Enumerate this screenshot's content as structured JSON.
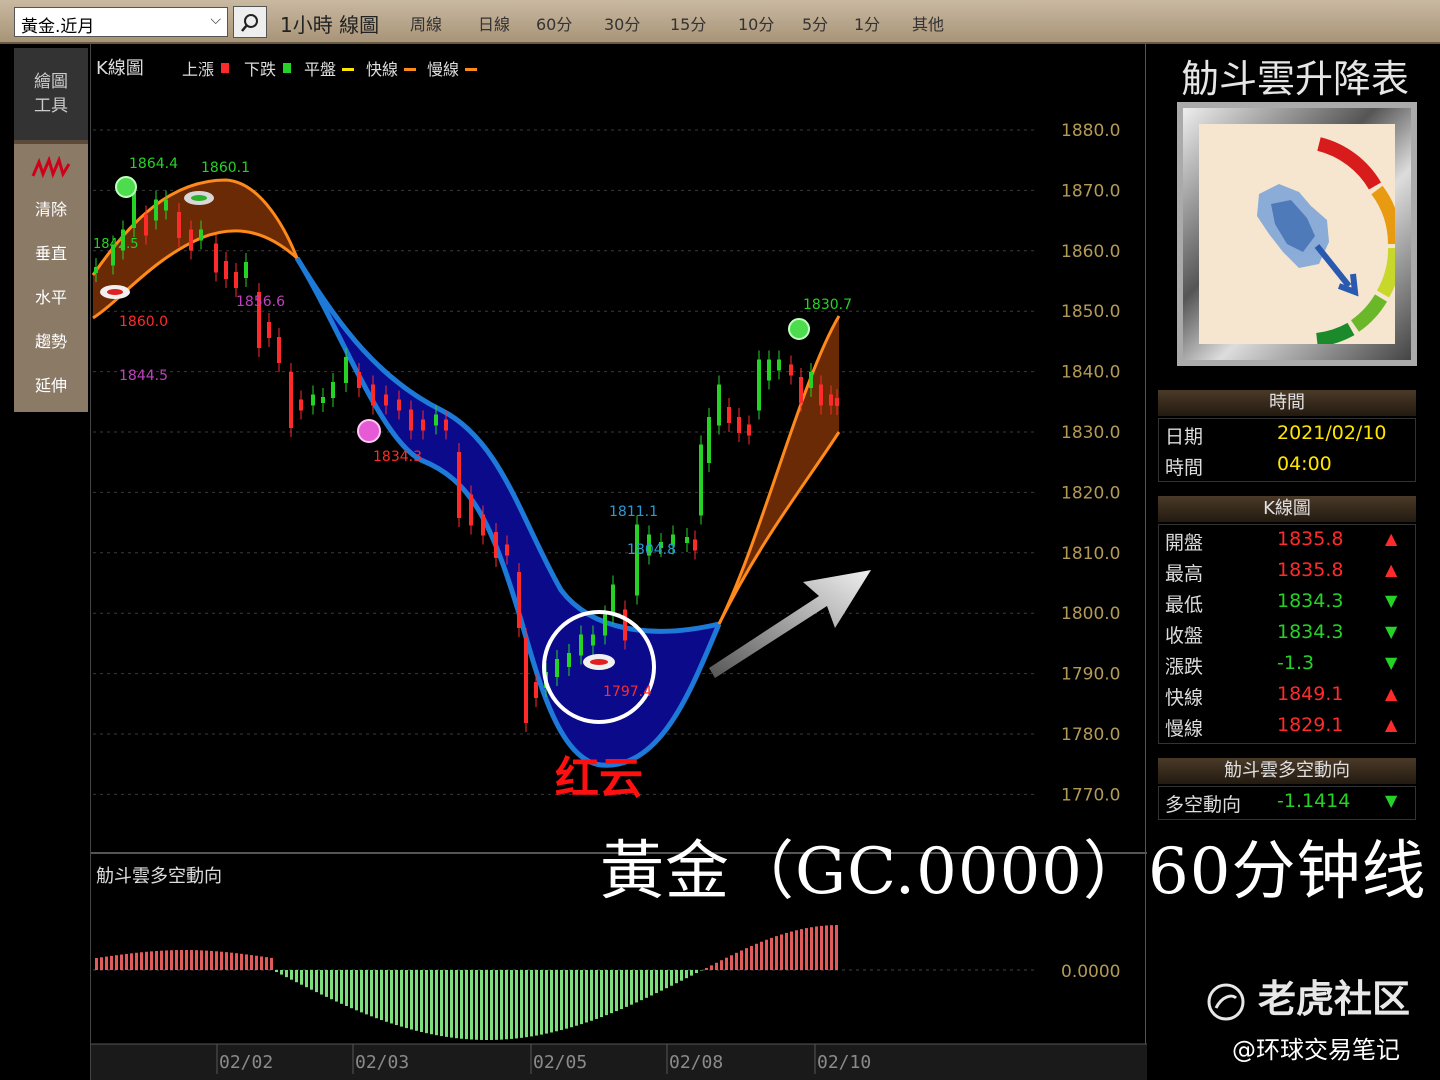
{
  "toolbar": {
    "symbol": "黃金.近月",
    "period": "1小時 線圖",
    "tabs": [
      "周線",
      "日線",
      "60分",
      "30分",
      "15分",
      "10分",
      "5分",
      "1分",
      "其他"
    ]
  },
  "left_tools": {
    "header_line1": "繪圖",
    "header_line2": "工具",
    "items": [
      "清除",
      "垂直",
      "水平",
      "趨勢",
      "延伸"
    ]
  },
  "legend": {
    "title": "K線圖",
    "items": [
      {
        "label": "上漲",
        "color": "#ff2a2a"
      },
      {
        "label": "下跌",
        "color": "#26d226"
      },
      {
        "label": "平盤",
        "color": "#ffe600"
      },
      {
        "label": "快線",
        "color": "#ff8a1a"
      },
      {
        "label": "慢線",
        "color": "#ff8a1a"
      }
    ]
  },
  "sub_chart_title": "觔斗雲多空動向",
  "sub_chart_value": "0.0000",
  "chart_data": {
    "type": "candlestick",
    "y_ticks": [
      "1880.0",
      "1870.0",
      "1860.0",
      "1850.0",
      "1840.0",
      "1830.0",
      "1820.0",
      "1810.0",
      "1800.0",
      "1790.0",
      "1780.0",
      "1770.0"
    ],
    "ylim": [
      1767,
      1885
    ],
    "x_ticks": [
      "02/02",
      "02/03",
      "02/05",
      "02/08",
      "02/10"
    ],
    "annotations": [
      {
        "text": "1864.4",
        "color": "#26d226"
      },
      {
        "text": "1860.1",
        "color": "#26d226"
      },
      {
        "text": "1842.5",
        "color": "#26d226"
      },
      {
        "text": "1860.0",
        "color": "#ff2a2a"
      },
      {
        "text": "1844.5",
        "color": "#c040c0"
      },
      {
        "text": "1856.6",
        "color": "#c040c0"
      },
      {
        "text": "1834.3",
        "color": "#ff2a2a"
      },
      {
        "text": "1811.1",
        "color": "#2a9ad6"
      },
      {
        "text": "1804.8",
        "color": "#2a9ad6"
      },
      {
        "text": "1797.4",
        "color": "#ff2a2a"
      },
      {
        "text": "1830.7",
        "color": "#26d226"
      }
    ]
  },
  "overlay": {
    "title": "黃金（GC.0000）60分钟线",
    "cloud_label": "红云"
  },
  "right_panel": {
    "title": "觔斗雲升降表",
    "time_head": "時間",
    "date_label": "日期",
    "date_value": "2021/02/10",
    "time_label": "時間",
    "time_value": "04:00",
    "k_head": "K線圖",
    "k_rows": [
      {
        "label": "開盤",
        "value": "1835.8",
        "arrow": "▲",
        "color": "red"
      },
      {
        "label": "最高",
        "value": "1835.8",
        "arrow": "▲",
        "color": "red"
      },
      {
        "label": "最低",
        "value": "1834.3",
        "arrow": "▼",
        "color": "green"
      },
      {
        "label": "收盤",
        "value": "1834.3",
        "arrow": "▼",
        "color": "green"
      },
      {
        "label": "漲跌",
        "value": "-1.3",
        "arrow": "▼",
        "color": "green"
      },
      {
        "label": "快線",
        "value": "1849.1",
        "arrow": "▲",
        "color": "red"
      },
      {
        "label": "慢線",
        "value": "1829.1",
        "arrow": "▲",
        "color": "red"
      }
    ],
    "dir_head": "觔斗雲多空動向",
    "dir_label": "多空動向",
    "dir_value": "-1.1414",
    "dir_arrow": "▼"
  },
  "watermark": {
    "brand": "老虎社区",
    "handle": "@环球交易笔记"
  }
}
